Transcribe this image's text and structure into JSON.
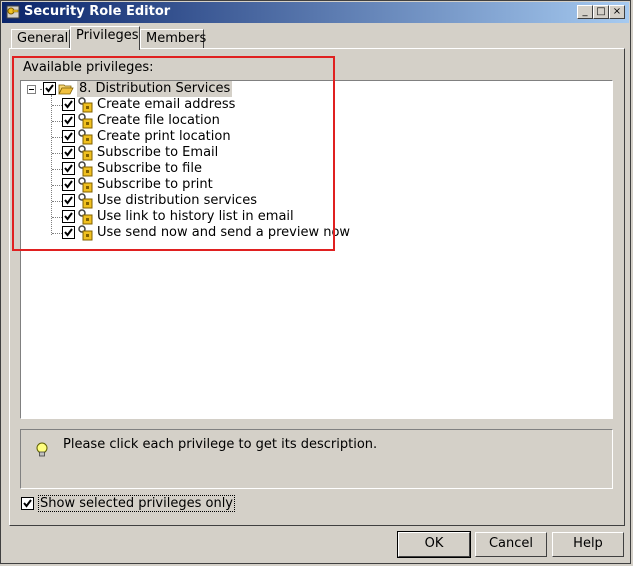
{
  "window": {
    "title": "Security Role Editor",
    "controls": [
      "_",
      "□",
      "×"
    ]
  },
  "tabs": [
    {
      "label": "General",
      "active": false
    },
    {
      "label": "Privileges",
      "active": true
    },
    {
      "label": "Members",
      "active": false
    }
  ],
  "privileges": {
    "label": "Available privileges:",
    "root": {
      "label": "8. Distribution Services",
      "checked": true,
      "expanded": true
    },
    "items": [
      {
        "label": "Create email address",
        "checked": true
      },
      {
        "label": "Create file location",
        "checked": true
      },
      {
        "label": "Create print location",
        "checked": true
      },
      {
        "label": "Subscribe to Email",
        "checked": true
      },
      {
        "label": "Subscribe to file",
        "checked": true
      },
      {
        "label": "Subscribe to print",
        "checked": true
      },
      {
        "label": "Use distribution services",
        "checked": true
      },
      {
        "label": "Use link to history list in email",
        "checked": true
      },
      {
        "label": "Use send now and send a preview now",
        "checked": true
      }
    ]
  },
  "description": {
    "text": "Please click each privilege to get its description."
  },
  "show_selected": {
    "label": "Show selected privileges only",
    "checked": true
  },
  "buttons": {
    "ok": "OK",
    "cancel": "Cancel",
    "help": "Help"
  },
  "colors": {
    "highlight_box": "#e02020",
    "titlebar_start": "#0a246a",
    "titlebar_end": "#a6caf0"
  }
}
